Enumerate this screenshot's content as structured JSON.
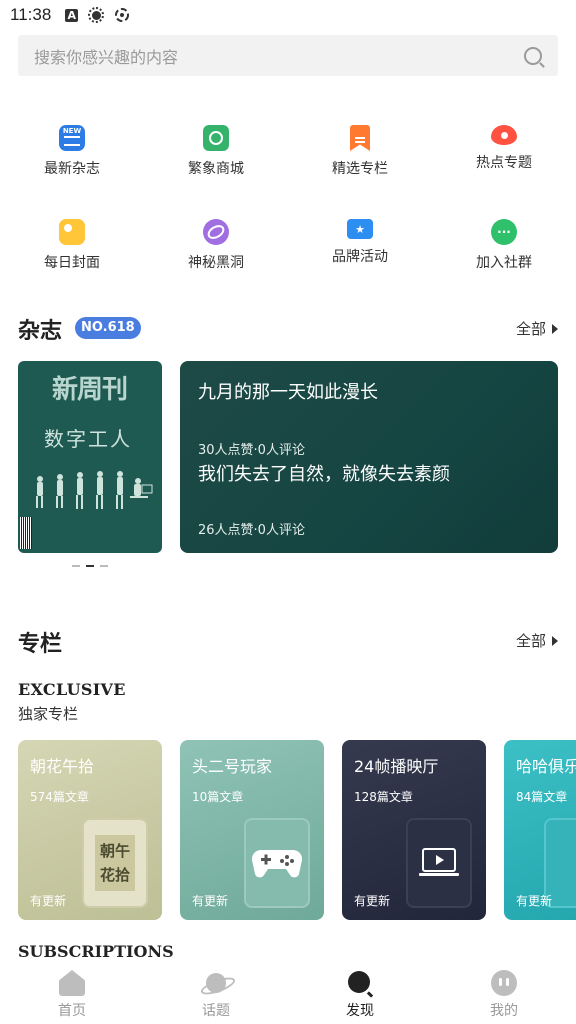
{
  "status_bar": {
    "time": "11:38"
  },
  "search": {
    "placeholder": "搜索你感兴趣的内容"
  },
  "quick_grid": [
    {
      "label": "最新杂志",
      "icon": "new-magazine-icon"
    },
    {
      "label": "繁象商城",
      "icon": "shopping-bag-icon"
    },
    {
      "label": "精选专栏",
      "icon": "bookmark-icon"
    },
    {
      "label": "热点专题",
      "icon": "eye-icon"
    },
    {
      "label": "每日封面",
      "icon": "picture-icon"
    },
    {
      "label": "神秘黑洞",
      "icon": "black-hole-icon"
    },
    {
      "label": "品牌活动",
      "icon": "ticket-icon"
    },
    {
      "label": "加入社群",
      "icon": "chat-icon"
    }
  ],
  "magazine": {
    "title": "杂志",
    "badge": "NO.618",
    "all_label": "全部",
    "cover": {
      "name": "新周刊",
      "topic": "数字工人"
    },
    "articles": [
      {
        "title": "九月的那一天如此漫长",
        "meta": "30人点赞·0人评论"
      },
      {
        "title": "我们失去了自然，就像失去素颜",
        "meta": "26人点赞·0人评论"
      }
    ]
  },
  "columns": {
    "title": "专栏",
    "all_label": "全部",
    "exclusive_en": "EXCLUSIVE",
    "exclusive_cn": "独家专栏",
    "cards": [
      {
        "title": "朝花午拾",
        "count": "574篇文章",
        "update": "有更新",
        "art": "朝午花拾"
      },
      {
        "title": "头二号玩家",
        "count": "10篇文章",
        "update": "有更新"
      },
      {
        "title": "24帧播映厅",
        "count": "128篇文章",
        "update": "有更新"
      },
      {
        "title": "哈哈俱乐",
        "count": "84篇文章",
        "update": "有更新"
      }
    ],
    "subscriptions_en": "SUBSCRIPTIONS"
  },
  "bottom_nav": [
    {
      "label": "首页",
      "icon": "home-icon"
    },
    {
      "label": "话题",
      "icon": "planet-icon"
    },
    {
      "label": "发现",
      "icon": "discover-icon",
      "active": true
    },
    {
      "label": "我的",
      "icon": "profile-icon"
    }
  ]
}
